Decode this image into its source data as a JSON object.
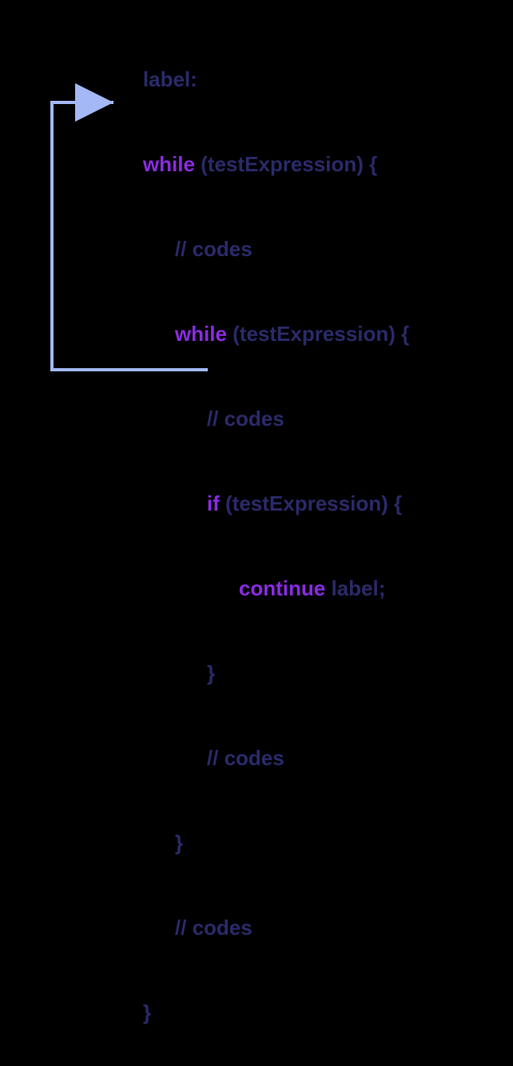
{
  "diagram": {
    "label_line": "label:",
    "outer_while_kw": "while",
    "outer_while_cond": " (testExpression) {",
    "codes_comment": "// codes",
    "inner_while_kw": "while",
    "inner_while_cond": " (testExpression) {",
    "if_kw": "if",
    "if_cond": " (testExpression) {",
    "continue_kw": "continue",
    "continue_target": " label;",
    "close_brace": "}",
    "arrow_color": "#a3b8f5"
  }
}
